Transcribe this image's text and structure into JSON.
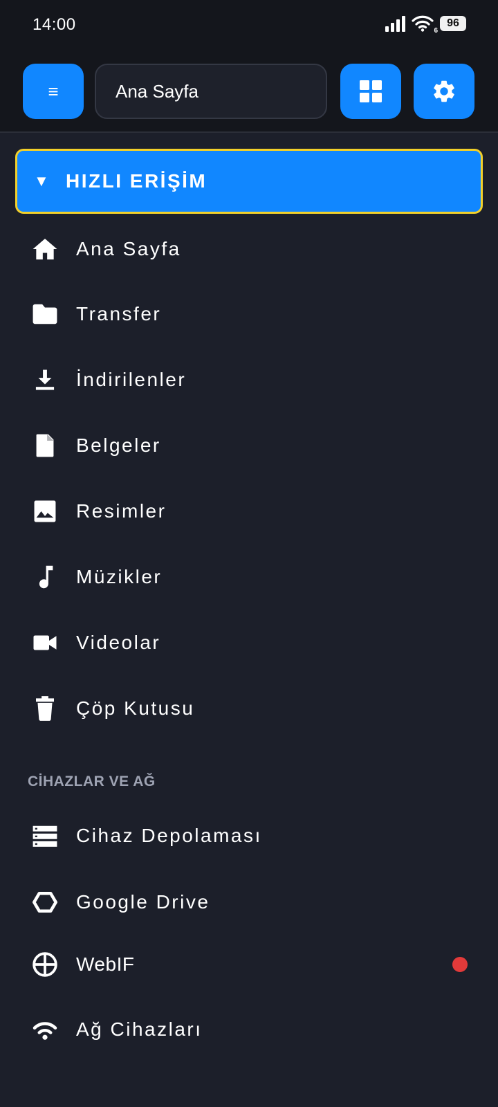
{
  "status_bar": {
    "time": "14:00",
    "battery": "96",
    "wifi_badge": "6"
  },
  "toolbar": {
    "menu_glyph": "≡",
    "location": "Ana Sayfa",
    "grid_icon": "grid-view-icon",
    "settings_icon": "gear-icon"
  },
  "quick_access": {
    "arrow": "▼",
    "title": "HIZLI ERİŞİM",
    "items": [
      {
        "label": "Ana Sayfa",
        "icon": "home-icon"
      },
      {
        "label": "Transfer",
        "icon": "folder-icon"
      },
      {
        "label": "İndirilenler",
        "icon": "download-icon"
      },
      {
        "label": "Belgeler",
        "icon": "document-icon"
      },
      {
        "label": "Resimler",
        "icon": "image-icon"
      },
      {
        "label": "Müzikler",
        "icon": "music-note-icon"
      },
      {
        "label": "Videolar",
        "icon": "video-camera-icon"
      },
      {
        "label": "Çöp Kutusu",
        "icon": "trash-icon"
      }
    ]
  },
  "devices_network": {
    "title": "CİHAZLAR VE AĞ",
    "items": [
      {
        "label": "Cihaz Depolaması",
        "icon": "storage-icon"
      },
      {
        "label": "Google Drive",
        "icon": "hexagon-drive-icon"
      },
      {
        "label": "WebIF",
        "icon": "globe-icon",
        "notification": true
      },
      {
        "label": "Ağ Cihazları",
        "icon": "network-wifi-icon"
      }
    ]
  },
  "colors": {
    "accent": "#1187ff",
    "header_border": "#f3d02a",
    "background": "#1c1f2a",
    "topbar": "#14161c",
    "notification": "#e23a3a",
    "muted_text": "#9ea3b3"
  }
}
